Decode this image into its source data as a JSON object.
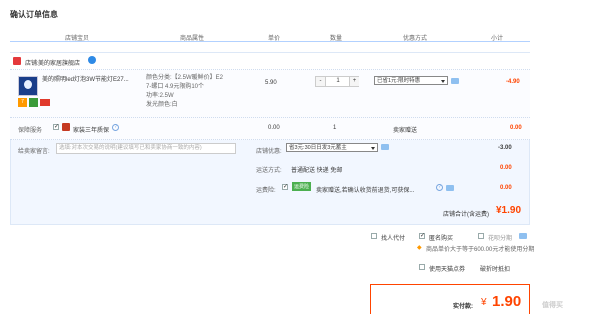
{
  "page_title": "确认订单信息",
  "columns": [
    "店铺宝贝",
    "商品属性",
    "单价",
    "数量",
    "优惠方式",
    "小计"
  ],
  "shop": {
    "prefix": "店铺:",
    "name": "美的家居旗舰店"
  },
  "item": {
    "name": "美的照明led灯泡3W节能灯E27...",
    "attr_line1": "颜色分类:【2.5W暖鲜价】E2",
    "attr_line2": "7-螺口 4.9元限购10个",
    "attr_line3": "功率:2.5W",
    "attr_line4": "发光颜色:白",
    "price": "5.90",
    "qty": "1",
    "qty_minus": "-",
    "qty_plus": "+",
    "promo": "已省1元:限时特惠",
    "subtotal": "-4.90"
  },
  "service": {
    "label": "保障服务",
    "option": "家装三年质保",
    "price": "0.00",
    "qty": "1",
    "note": "卖家赠送",
    "subtotal": "0.00"
  },
  "message": {
    "label": "给卖家留言:",
    "placeholder": "选填:对本次交易的说明(建议填写已和卖家协商一致的内容)"
  },
  "shop_discount": {
    "label": "店铺优惠:",
    "value": "省3元:30日日发3元蓄主",
    "amount": "-3.00"
  },
  "shipping": {
    "label": "运送方式:",
    "value": "普通配送 快递 免邮",
    "amount": "0.00"
  },
  "insurance": {
    "label": "运费险:",
    "badge": "运费险",
    "value": "卖家赠送,若确认收货前退货,可获保...",
    "amount": "0.00"
  },
  "shop_total": {
    "label": "店铺合计(含运费)",
    "amount": "¥1.90"
  },
  "options": {
    "proxy_pay": "找人代付",
    "anonymous": "匿名购买",
    "installment": "花呗分期",
    "installment_note": "商品单价大于等于600.00元才能使用分期"
  },
  "coupon": {
    "label": "使用天猫点券",
    "link": "破折时抵扣"
  },
  "pay": {
    "label": "实付款:",
    "currency": "¥",
    "amount": "1.90"
  },
  "watermark": "值得买"
}
